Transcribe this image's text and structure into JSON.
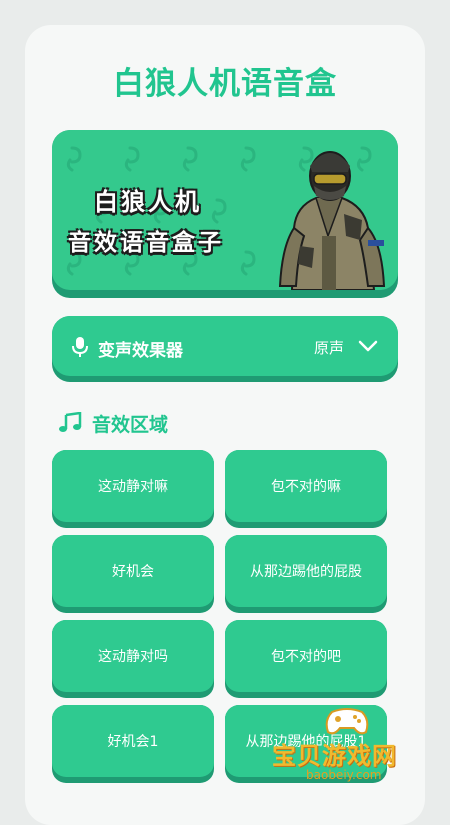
{
  "app": {
    "title": "白狼人机语音盒"
  },
  "banner": {
    "line1": "白狼人机",
    "line2": "音效语音盒子"
  },
  "voice_changer": {
    "label": "变声效果器",
    "value": "原声",
    "icon": "mic-icon"
  },
  "section": {
    "title": "音效区域",
    "icon": "music-note-icon"
  },
  "sounds": [
    {
      "label": "这动静对嘛"
    },
    {
      "label": "包不对的嘛"
    },
    {
      "label": "好机会"
    },
    {
      "label": "从那边踢他的屁股"
    },
    {
      "label": "这动静对吗"
    },
    {
      "label": "包不对的吧"
    },
    {
      "label": "好机会1"
    },
    {
      "label": "从那边踢他的屁股1"
    }
  ],
  "watermark": {
    "text": "宝贝游戏网",
    "url": "baobeiy.com"
  },
  "colors": {
    "accent": "#2fca90",
    "accent_dark": "#1f9b73",
    "title": "#21c58f",
    "background": "#f6f8f7"
  }
}
